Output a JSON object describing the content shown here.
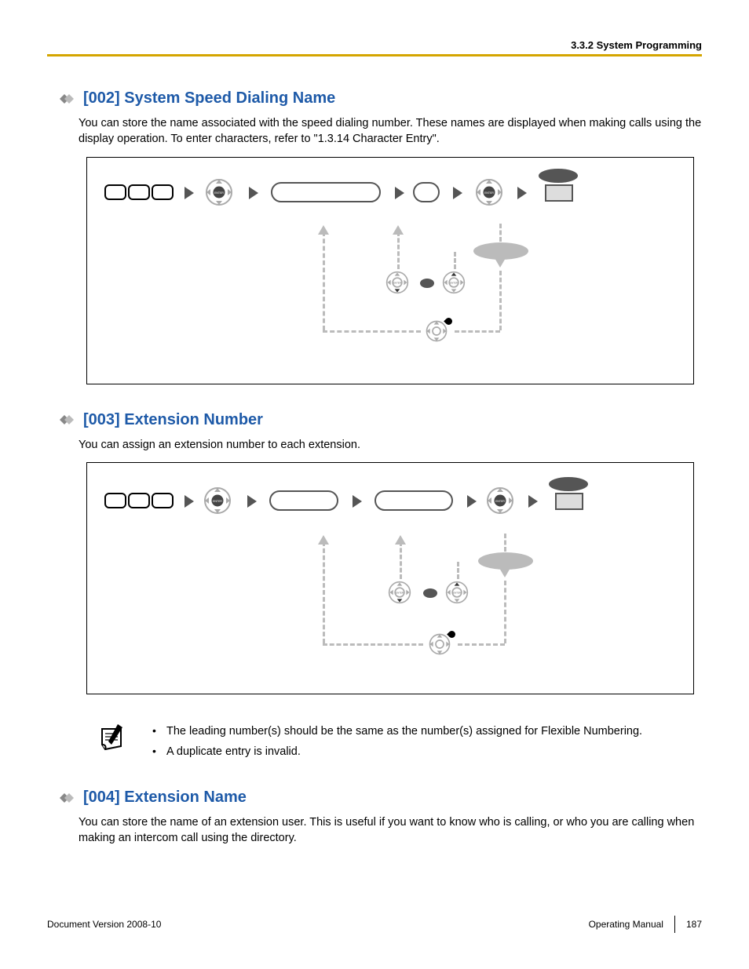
{
  "header": {
    "section": "3.3.2 System Programming"
  },
  "sections": [
    {
      "heading": "[002] System Speed Dialing Name",
      "body": "You can store the name associated with the speed dialing number. These names are displayed when making calls using the display operation. To enter characters, refer to \"1.3.14  Character Entry\"."
    },
    {
      "heading": "[003] Extension Number",
      "body": "You can assign an extension number to each extension.",
      "notes": [
        "The leading number(s) should be the same as the number(s) assigned for Flexible Numbering.",
        "A duplicate entry is invalid."
      ]
    },
    {
      "heading": "[004] Extension Name",
      "body": "You can store the name of an extension user. This is useful if you want to know who is calling, or who you are calling when making an intercom call using the directory."
    }
  ],
  "footer": {
    "left": "Document Version  2008-10",
    "right_label": "Operating Manual",
    "page": "187"
  }
}
